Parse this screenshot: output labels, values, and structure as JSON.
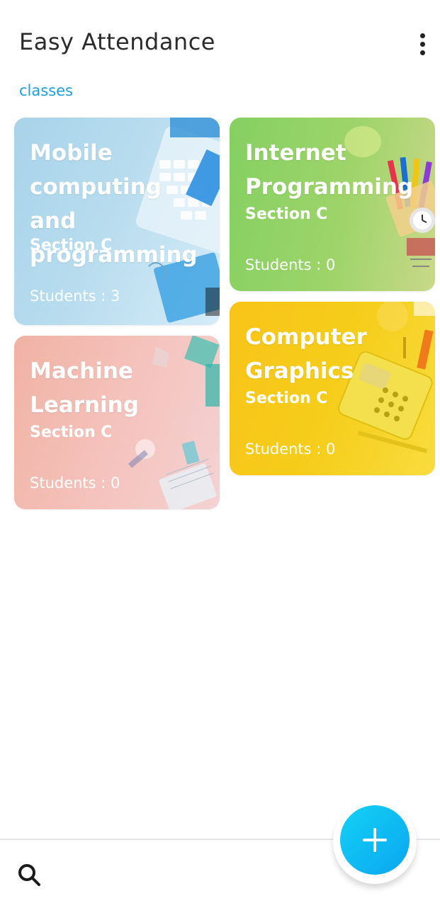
{
  "header": {
    "app_title": "Easy Attendance",
    "menu_icon": "more-vertical-icon"
  },
  "section_label": "classes",
  "classes": [
    {
      "title": "Mobile\ncomputing and\nprogramming",
      "section": "Section C",
      "students": "Students : 3",
      "color": "#a9d3ea"
    },
    {
      "title": "Internet\nProgramming",
      "section": "Section C",
      "students": "Students : 0",
      "color": "#85d062"
    },
    {
      "title": "Machine\nLearning",
      "section": "Section C",
      "students": "Students : 0",
      "color": "#f0b3a4"
    },
    {
      "title": "Computer\nGraphics",
      "section": "Section C",
      "students": "Students : 0",
      "color": "#f8c418"
    }
  ],
  "bottom_bar": {
    "search_icon": "search-icon",
    "add_icon": "plus-icon",
    "fab_color": "#0aa6f0"
  }
}
